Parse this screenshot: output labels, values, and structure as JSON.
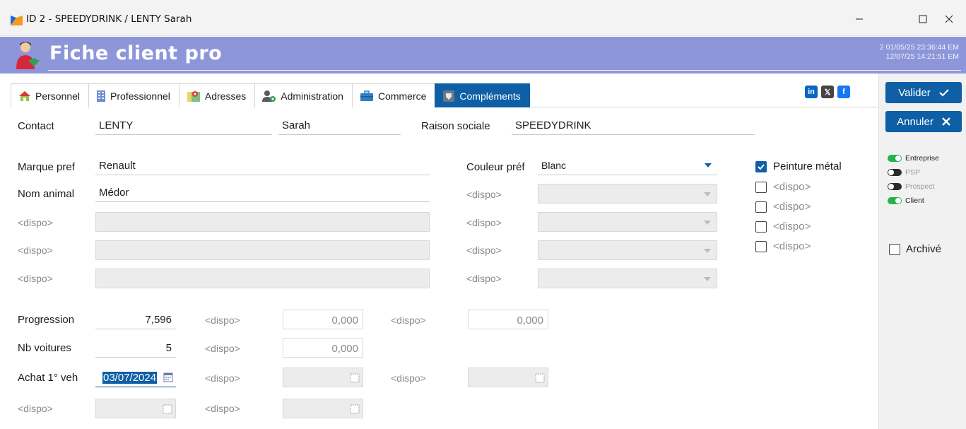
{
  "window": {
    "title": "ID 2 - SPEEDYDRINK / LENTY Sarah",
    "minimize": "—",
    "maximize": "☐",
    "close": "✕"
  },
  "header": {
    "title": "Fiche client pro",
    "stamp_line1": "2 01/05/25 23:36:44 EM",
    "stamp_line2": "12/07/25 14:21:51 EM",
    "color": "#8e96da"
  },
  "tabs": [
    {
      "label": "Personnel",
      "icon": "house-icon"
    },
    {
      "label": "Professionnel",
      "icon": "building-icon"
    },
    {
      "label": "Adresses",
      "icon": "map-icon"
    },
    {
      "label": "Administration",
      "icon": "user-gear-icon"
    },
    {
      "label": "Commerce",
      "icon": "briefcase-icon"
    },
    {
      "label": "Compléments",
      "icon": "shield-icon",
      "active": true
    }
  ],
  "social": {
    "linkedin": "in",
    "x": "𝕏",
    "facebook": "f"
  },
  "actions": {
    "validate": "Valider",
    "cancel": "Annuler",
    "accent": "#0e5fa5"
  },
  "statuses": [
    {
      "label": "Entreprise",
      "on": true
    },
    {
      "label": "PSP",
      "on": false
    },
    {
      "label": "Prospect",
      "on": false
    },
    {
      "label": "Client",
      "on": true
    }
  ],
  "archive": {
    "label": "Archivé",
    "checked": false
  },
  "contact": {
    "label": "Contact",
    "last_name": "LENTY",
    "first_name": "Sarah",
    "company_label": "Raison sociale",
    "company": "SPEEDYDRINK"
  },
  "rows": [
    {
      "label": "Marque pref",
      "value": "Renault",
      "select_label": "Couleur préf",
      "select_value": "Blanc"
    },
    {
      "label": "Nom animal",
      "value": "Médor",
      "select_label": "<dispo>",
      "select_value": ""
    },
    {
      "label": "<dispo>",
      "value": "",
      "select_label": "<dispo>",
      "select_value": ""
    },
    {
      "label": "<dispo>",
      "value": "",
      "select_label": "<dispo>",
      "select_value": ""
    },
    {
      "label": "<dispo>",
      "value": "",
      "select_label": "<dispo>",
      "select_value": ""
    }
  ],
  "checkboxes": [
    {
      "label": "Peinture métal",
      "checked": true
    },
    {
      "label": "<dispo>",
      "checked": false
    },
    {
      "label": "<dispo>",
      "checked": false
    },
    {
      "label": "<dispo>",
      "checked": false
    },
    {
      "label": "<dispo>",
      "checked": false
    }
  ],
  "numbers": {
    "progression_label": "Progression",
    "progression_value": "7,596",
    "nb_label": "Nb  voitures",
    "nb_value": "5",
    "dispo": "<dispo>",
    "zero": "0,000"
  },
  "dates": {
    "achat_label": "Achat 1° veh",
    "achat_value": "03/07/2024",
    "dispo": "<dispo>"
  }
}
